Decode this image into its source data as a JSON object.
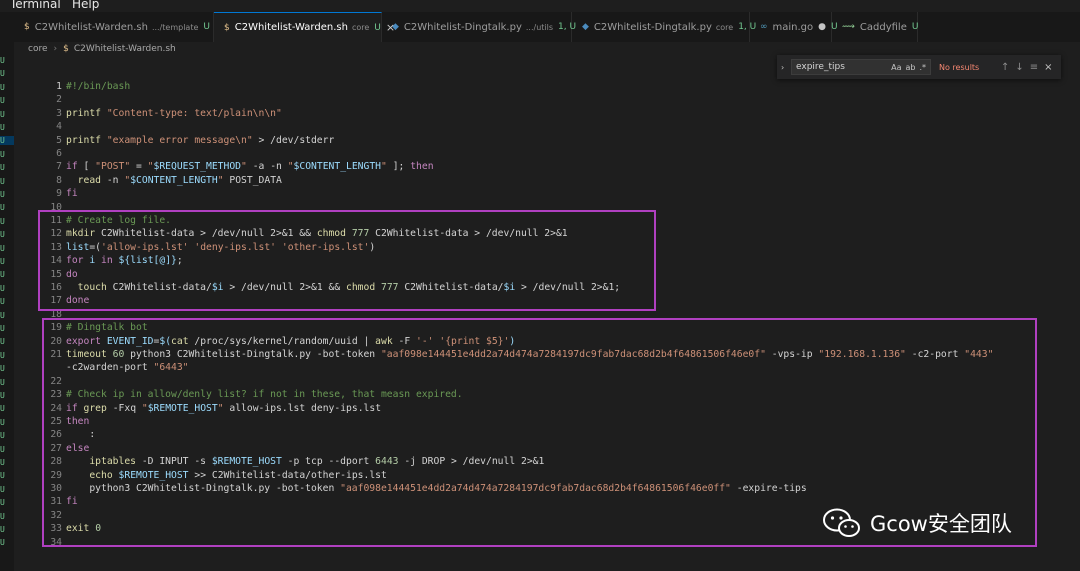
{
  "menubar": {
    "terminal": "Terminal",
    "help": "Help"
  },
  "tabs": [
    {
      "icon": "$",
      "name": "C2Whitelist-Warden.sh",
      "dir": ".../template",
      "status": "U",
      "active": false
    },
    {
      "icon": "$",
      "name": "C2Whitelist-Warden.sh",
      "dir": "core",
      "status": "U",
      "active": true,
      "close": "×"
    },
    {
      "icon": "◆",
      "name": "C2Whitelist-Dingtalk.py",
      "dir": ".../utils",
      "status": "1, U",
      "active": false
    },
    {
      "icon": "◆",
      "name": "C2Whitelist-Dingtalk.py",
      "dir": "core",
      "status": "1, U",
      "active": false
    },
    {
      "icon": "∞",
      "name": "main.go",
      "dir": "",
      "status": "U",
      "active": false,
      "dot": "●"
    },
    {
      "icon": "⟿",
      "name": "Caddyfile",
      "dir": "",
      "status": "U",
      "active": false
    }
  ],
  "breadcrumb": {
    "folder": "core",
    "sep": "›",
    "file": "C2Whitelist-Warden.sh",
    "file_icon": "$"
  },
  "find": {
    "toggle": "›",
    "value": "expire_tips",
    "opt_case": "Aa",
    "opt_word": "ab",
    "opt_regex": ".*",
    "result": "No results",
    "prev": "↑",
    "next": "↓",
    "selection": "≡",
    "close": "×"
  },
  "left_gutter_marks": [
    "U",
    "U",
    "U",
    "U",
    "U",
    "U",
    "U",
    "U",
    "U",
    "U",
    "U",
    "U",
    "U",
    "U",
    "U",
    "U",
    "U",
    "U",
    "U",
    "U",
    "U",
    "U",
    "U",
    "U",
    "U",
    "U",
    "U",
    "U",
    "U",
    "U",
    "U",
    "U",
    "U",
    "U",
    "U",
    "U",
    "U"
  ],
  "code_lines": [
    {
      "n": "1",
      "tokens": [
        [
          "cm",
          "#!/bin/bash"
        ]
      ]
    },
    {
      "n": "2",
      "tokens": []
    },
    {
      "n": "3",
      "tokens": [
        [
          "fn",
          "printf"
        ],
        [
          "tx",
          " "
        ],
        [
          "str",
          "\"Content-type: text/plain\\n\\n\""
        ]
      ]
    },
    {
      "n": "4",
      "tokens": []
    },
    {
      "n": "5",
      "tokens": [
        [
          "fn",
          "printf"
        ],
        [
          "tx",
          " "
        ],
        [
          "str",
          "\"example error message\\n\""
        ],
        [
          "tx",
          " > /dev/stderr"
        ]
      ]
    },
    {
      "n": "6",
      "tokens": []
    },
    {
      "n": "7",
      "tokens": [
        [
          "kw",
          "if"
        ],
        [
          "tx",
          " [ "
        ],
        [
          "str",
          "\"POST\""
        ],
        [
          "tx",
          " = "
        ],
        [
          "str",
          "\""
        ],
        [
          "var",
          "$REQUEST_METHOD"
        ],
        [
          "str",
          "\""
        ],
        [
          "tx",
          " -a -n "
        ],
        [
          "str",
          "\""
        ],
        [
          "var",
          "$CONTENT_LENGTH"
        ],
        [
          "str",
          "\""
        ],
        [
          "tx",
          " ]; "
        ],
        [
          "kw",
          "then"
        ]
      ]
    },
    {
      "n": "8",
      "tokens": [
        [
          "tx",
          "  "
        ],
        [
          "fn",
          "read"
        ],
        [
          "tx",
          " -n "
        ],
        [
          "str",
          "\""
        ],
        [
          "var",
          "$CONTENT_LENGTH"
        ],
        [
          "str",
          "\""
        ],
        [
          "tx",
          " POST_DATA"
        ]
      ]
    },
    {
      "n": "9",
      "tokens": [
        [
          "kw",
          "fi"
        ]
      ]
    },
    {
      "n": "10",
      "tokens": []
    },
    {
      "n": "11",
      "tokens": [
        [
          "cm",
          "# Create log file."
        ]
      ]
    },
    {
      "n": "12",
      "tokens": [
        [
          "fn",
          "mkdir"
        ],
        [
          "tx",
          " C2Whitelist-data > /dev/null 2>&1 && "
        ],
        [
          "fn",
          "chmod"
        ],
        [
          "tx",
          " "
        ],
        [
          "num",
          "777"
        ],
        [
          "tx",
          " C2Whitelist-data > /dev/null 2>&1"
        ]
      ]
    },
    {
      "n": "13",
      "tokens": [
        [
          "var",
          "list"
        ],
        [
          "tx",
          "=("
        ],
        [
          "str",
          "'allow-ips.lst'"
        ],
        [
          "tx",
          " "
        ],
        [
          "str",
          "'deny-ips.lst'"
        ],
        [
          "tx",
          " "
        ],
        [
          "str",
          "'other-ips.lst'"
        ],
        [
          "tx",
          ")"
        ]
      ]
    },
    {
      "n": "14",
      "tokens": [
        [
          "kw",
          "for"
        ],
        [
          "tx",
          " "
        ],
        [
          "var",
          "i"
        ],
        [
          "tx",
          " "
        ],
        [
          "kw",
          "in"
        ],
        [
          "tx",
          " "
        ],
        [
          "var",
          "${list[@]}"
        ],
        [
          "tx",
          ";"
        ]
      ]
    },
    {
      "n": "15",
      "tokens": [
        [
          "kw",
          "do"
        ]
      ]
    },
    {
      "n": "16",
      "tokens": [
        [
          "tx",
          "  "
        ],
        [
          "fn",
          "touch"
        ],
        [
          "tx",
          " C2Whitelist-data/"
        ],
        [
          "var",
          "$i"
        ],
        [
          "tx",
          " > /dev/null 2>&1 && "
        ],
        [
          "fn",
          "chmod"
        ],
        [
          "tx",
          " "
        ],
        [
          "num",
          "777"
        ],
        [
          "tx",
          " C2Whitelist-data/"
        ],
        [
          "var",
          "$i"
        ],
        [
          "tx",
          " > /dev/null 2>&1;"
        ]
      ]
    },
    {
      "n": "17",
      "tokens": [
        [
          "kw",
          "done"
        ]
      ]
    },
    {
      "n": "18",
      "tokens": []
    },
    {
      "n": "19",
      "tokens": [
        [
          "cm",
          "# Dingtalk bot"
        ]
      ]
    },
    {
      "n": "20",
      "tokens": [
        [
          "kw",
          "export"
        ],
        [
          "tx",
          " "
        ],
        [
          "var",
          "EVENT_ID"
        ],
        [
          "tx",
          "="
        ],
        [
          "var",
          "$("
        ],
        [
          "fn",
          "cat"
        ],
        [
          "tx",
          " /proc/sys/kernel/random/uuid | "
        ],
        [
          "fn",
          "awk"
        ],
        [
          "tx",
          " -F "
        ],
        [
          "str",
          "'-'"
        ],
        [
          "tx",
          " "
        ],
        [
          "str",
          "'{print $5}'"
        ],
        [
          "var",
          ")"
        ]
      ]
    },
    {
      "n": "21",
      "tokens": [
        [
          "fn",
          "timeout"
        ],
        [
          "tx",
          " "
        ],
        [
          "num",
          "60"
        ],
        [
          "tx",
          " python3 C2Whitelist-Dingtalk.py -bot-token "
        ],
        [
          "str",
          "\"aaf098e144451e4dd2a74d474a7284197dc9fab7dac68d2b4f64861506f46e0f\""
        ],
        [
          "tx",
          " -vps-ip "
        ],
        [
          "str",
          "\"192.168.1.136\""
        ],
        [
          "tx",
          " -c2-port "
        ],
        [
          "str",
          "\"443\""
        ]
      ]
    },
    {
      "n": "",
      "tokens": [
        [
          "tx",
          "-c2warden-port "
        ],
        [
          "str",
          "\"6443\""
        ]
      ]
    },
    {
      "n": "22",
      "tokens": []
    },
    {
      "n": "23",
      "tokens": [
        [
          "cm",
          "# Check ip in allow/denly list? if not in these, that measn expired."
        ]
      ]
    },
    {
      "n": "24",
      "tokens": [
        [
          "kw",
          "if"
        ],
        [
          "tx",
          " "
        ],
        [
          "fn",
          "grep"
        ],
        [
          "tx",
          " -Fxq "
        ],
        [
          "str",
          "\""
        ],
        [
          "var",
          "$REMOTE_HOST"
        ],
        [
          "str",
          "\""
        ],
        [
          "tx",
          " allow-ips.lst deny-ips.lst"
        ]
      ]
    },
    {
      "n": "25",
      "tokens": [
        [
          "kw",
          "then"
        ]
      ]
    },
    {
      "n": "26",
      "tokens": [
        [
          "tx",
          "    :"
        ]
      ]
    },
    {
      "n": "27",
      "tokens": [
        [
          "kw",
          "else"
        ]
      ]
    },
    {
      "n": "28",
      "tokens": [
        [
          "tx",
          "    "
        ],
        [
          "fn",
          "iptables"
        ],
        [
          "tx",
          " -D INPUT -s "
        ],
        [
          "var",
          "$REMOTE_HOST"
        ],
        [
          "tx",
          " -p tcp --dport "
        ],
        [
          "num",
          "6443"
        ],
        [
          "tx",
          " -j DROP > /dev/null 2>&1"
        ]
      ]
    },
    {
      "n": "29",
      "tokens": [
        [
          "tx",
          "    "
        ],
        [
          "fn",
          "echo"
        ],
        [
          "tx",
          " "
        ],
        [
          "var",
          "$REMOTE_HOST"
        ],
        [
          "tx",
          " >> C2Whitelist-data/other-ips.lst"
        ]
      ]
    },
    {
      "n": "30",
      "tokens": [
        [
          "tx",
          "    python3 C2Whitelist-Dingtalk.py -bot-token "
        ],
        [
          "str",
          "\"aaf098e144451e4dd2a74d474a7284197dc9fab7dac68d2b4f64861506f46e0ff\""
        ],
        [
          "tx",
          " -expire-tips"
        ]
      ]
    },
    {
      "n": "31",
      "tokens": [
        [
          "kw",
          "fi"
        ]
      ]
    },
    {
      "n": "32",
      "tokens": []
    },
    {
      "n": "33",
      "tokens": [
        [
          "fn",
          "exit"
        ],
        [
          "tx",
          " "
        ],
        [
          "num",
          "0"
        ]
      ]
    },
    {
      "n": "34",
      "tokens": []
    }
  ],
  "watermark": {
    "text": "Gcow安全团队"
  }
}
